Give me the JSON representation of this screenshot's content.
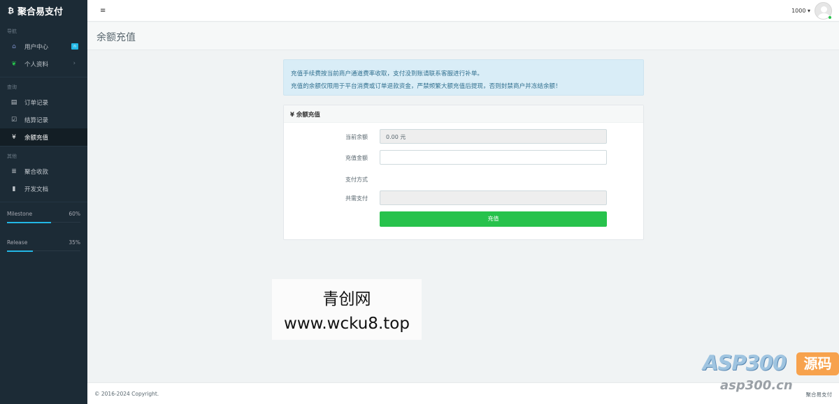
{
  "brand": {
    "logo": "₿",
    "name": "聚合易支付"
  },
  "sidebar": {
    "sections": [
      {
        "heading": "导航",
        "items": [
          {
            "icon": "home-icon",
            "glyph": "⌂",
            "label": "用户中心",
            "badge": "n"
          },
          {
            "icon": "leaf-icon",
            "glyph": "❦",
            "label": "个人资料",
            "chevron": "›"
          }
        ]
      },
      {
        "heading": "查询",
        "items": [
          {
            "icon": "list-icon",
            "glyph": "▤",
            "label": "订单记录"
          },
          {
            "icon": "check-square-icon",
            "glyph": "☑",
            "label": "结算记录"
          },
          {
            "icon": "yen-icon",
            "glyph": "¥",
            "label": "余额充值"
          }
        ]
      },
      {
        "heading": "其他",
        "items": [
          {
            "icon": "list-alt-icon",
            "glyph": "≣",
            "label": "聚合收款"
          },
          {
            "icon": "book-icon",
            "glyph": "▮",
            "label": "开发文档"
          }
        ]
      }
    ],
    "progress": [
      {
        "label": "Milestone",
        "value_text": "60%",
        "value": 0.6
      },
      {
        "label": "Release",
        "value_text": "35%",
        "value": 0.35
      }
    ]
  },
  "header": {
    "menu_icon": "≡",
    "user_label": "1000 ▾"
  },
  "page": {
    "title": "余额充值"
  },
  "notice": {
    "line1": "充值手续费按当前商户通道费率收取，支付没到账请联系客服进行补单。",
    "line2": "充值的余额仅限用于平台消费或订单退款资金，严禁频繁大额充值后提现，否则封禁商户并冻结余额！"
  },
  "form": {
    "panel_title": "¥ 余额充值",
    "current_balance_label": "当前余额",
    "current_balance_value": "0.00 元",
    "amount_label": "充值金额",
    "amount_value": "",
    "method_label": "支付方式",
    "total_label": "共需支付",
    "total_value": "",
    "submit_label": "充值"
  },
  "watermark": {
    "line1": "青创网",
    "line2": "www.wcku8.top"
  },
  "footer": {
    "copyright": "© 2016-2024 Copyright.",
    "right": "聚合易支付"
  },
  "asp_logo": {
    "text": "ASP300",
    "box": "源码",
    "url": "asp300.cn"
  },
  "colors": {
    "sidebar": "#1c2b36",
    "accent": "#23b7e5",
    "success": "#27c24c",
    "notice_bg": "#d9edf7"
  }
}
